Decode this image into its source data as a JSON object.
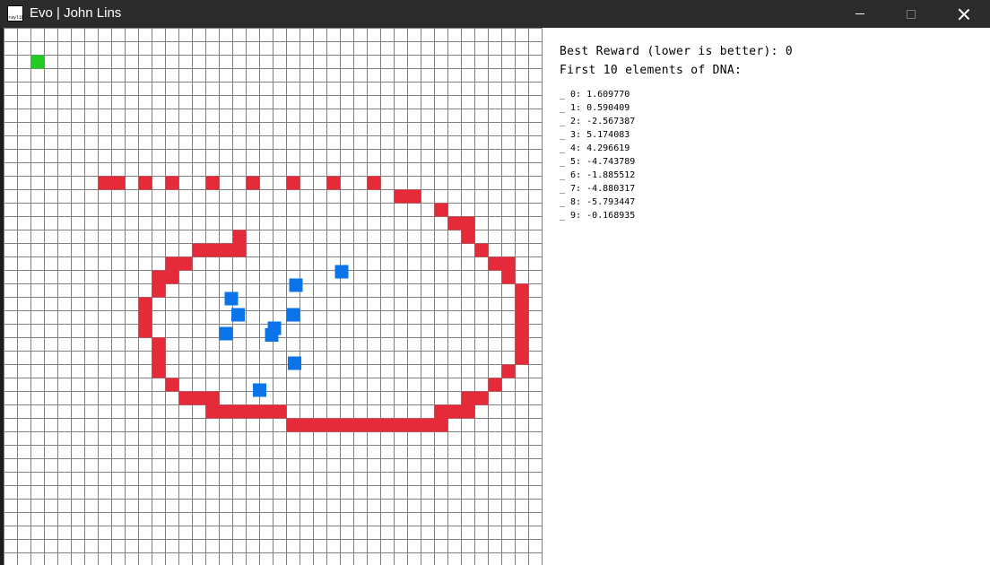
{
  "window": {
    "title": "Evo | John Lins",
    "app_icon_text": "raylib",
    "controls": {
      "minimize": "minimize-icon",
      "maximize": "maximize-icon",
      "close": "close-icon"
    }
  },
  "grid": {
    "cols": 40,
    "rows": 40,
    "line_color": "#808080",
    "colors": {
      "goal": "#22cc22",
      "wall": "#e52a3a",
      "agent": "#0a74e8"
    },
    "goal_cells": [
      [
        2,
        2
      ]
    ],
    "wall_cells": [
      [
        7,
        11
      ],
      [
        8,
        11
      ],
      [
        10,
        11
      ],
      [
        12,
        11
      ],
      [
        15,
        11
      ],
      [
        18,
        11
      ],
      [
        21,
        11
      ],
      [
        24,
        11
      ],
      [
        27,
        11
      ],
      [
        29,
        12
      ],
      [
        30,
        12
      ],
      [
        32,
        13
      ],
      [
        33,
        14
      ],
      [
        34,
        14
      ],
      [
        17,
        15
      ],
      [
        34,
        15
      ],
      [
        14,
        16
      ],
      [
        15,
        16
      ],
      [
        16,
        16
      ],
      [
        17,
        16
      ],
      [
        35,
        16
      ],
      [
        12,
        17
      ],
      [
        13,
        17
      ],
      [
        36,
        17
      ],
      [
        37,
        17
      ],
      [
        11,
        18
      ],
      [
        12,
        18
      ],
      [
        37,
        18
      ],
      [
        11,
        19
      ],
      [
        38,
        19
      ],
      [
        10,
        20
      ],
      [
        38,
        20
      ],
      [
        10,
        21
      ],
      [
        38,
        21
      ],
      [
        10,
        22
      ],
      [
        38,
        22
      ],
      [
        11,
        23
      ],
      [
        38,
        23
      ],
      [
        11,
        24
      ],
      [
        38,
        24
      ],
      [
        11,
        25
      ],
      [
        37,
        25
      ],
      [
        12,
        26
      ],
      [
        36,
        26
      ],
      [
        13,
        27
      ],
      [
        14,
        27
      ],
      [
        15,
        27
      ],
      [
        34,
        27
      ],
      [
        35,
        27
      ],
      [
        15,
        28
      ],
      [
        16,
        28
      ],
      [
        17,
        28
      ],
      [
        18,
        28
      ],
      [
        19,
        28
      ],
      [
        20,
        28
      ],
      [
        32,
        28
      ],
      [
        33,
        28
      ],
      [
        34,
        28
      ],
      [
        21,
        29
      ],
      [
        22,
        29
      ],
      [
        23,
        29
      ],
      [
        24,
        29
      ],
      [
        25,
        29
      ],
      [
        26,
        29
      ],
      [
        27,
        29
      ],
      [
        28,
        29
      ],
      [
        29,
        29
      ],
      [
        30,
        29
      ],
      [
        31,
        29
      ],
      [
        32,
        29
      ]
    ],
    "agent_positions": [
      [
        24.6,
        17.6
      ],
      [
        21.2,
        18.6
      ],
      [
        16.4,
        19.6
      ],
      [
        16.9,
        20.8
      ],
      [
        21.0,
        20.8
      ],
      [
        19.6,
        21.8
      ],
      [
        16.0,
        22.2
      ],
      [
        19.4,
        22.3
      ],
      [
        21.1,
        24.4
      ],
      [
        18.5,
        26.4
      ]
    ]
  },
  "info": {
    "best_reward": "Best Reward (lower is better): 0",
    "dna_header": "First 10 elements of DNA:",
    "dna": [
      "_ 0: 1.609770",
      "_ 1: 0.590409",
      "_ 2: -2.567387",
      "_ 3: 5.174083",
      "_ 4: 4.296619",
      "_ 5: -4.743789",
      "_ 6: -1.885512",
      "_ 7: -4.880317",
      "_ 8: -5.793447",
      "_ 9: -0.168935"
    ]
  }
}
